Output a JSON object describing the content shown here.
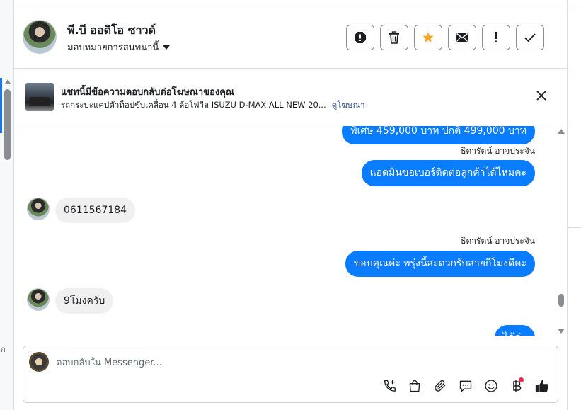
{
  "header": {
    "contact_name": "พี.บี ออดิโอ ซาวด์",
    "assign_label": "มอบหมายการสนทนานี้"
  },
  "ad": {
    "title": "แชทนี้มีข้อความตอบกลับต่อโฆษณาของคุณ",
    "description": "รถกระบะแคปตัวท็อปขับเคลื่อน 4 ล้อโฟวีล ISUZU D-MAX ALL NEW 20...",
    "link": "ดูโฆษณา"
  },
  "messages": [
    {
      "type": "out",
      "text": "พิเศษ 459,000 บาท  ปกติ 499,000 บาท"
    },
    {
      "type": "sender",
      "text": "ธิดารัตน์ อาจประจัน"
    },
    {
      "type": "out",
      "text": "แอดมินขอเบอร์ติดต่อลูกค้าได้ไหมคะ"
    },
    {
      "type": "in",
      "text": "0611567184"
    },
    {
      "type": "sender",
      "text": "ธิดารัตน์ อาจประจัน"
    },
    {
      "type": "out",
      "text": "ขอบคุณค่ะ พรุ่งนี้สะดวกรับสายกี่โมงดีคะ"
    },
    {
      "type": "in",
      "text": "9โมงครับ"
    },
    {
      "type": "out",
      "text": "ได้ค่ะ"
    }
  ],
  "composer": {
    "placeholder": "ตอบกลับใน Messenger..."
  },
  "left_edge": {
    "glyph": "ก"
  },
  "colors": {
    "outgoing_bubble": "#0a7cff",
    "incoming_bubble": "#f0f0f0",
    "star": "#f5a623",
    "link": "#385898",
    "notification_dot": "#f02849"
  },
  "icons": {
    "header_actions": [
      "spam-icon",
      "trash-icon",
      "star-icon",
      "envelope-icon",
      "exclamation-icon",
      "check-icon"
    ],
    "composer_tools": [
      "phone-plus-icon",
      "shopping-bag-icon",
      "paperclip-icon",
      "chat-bubble-icon",
      "emoji-icon",
      "baht-icon",
      "thumbs-up-icon"
    ]
  }
}
